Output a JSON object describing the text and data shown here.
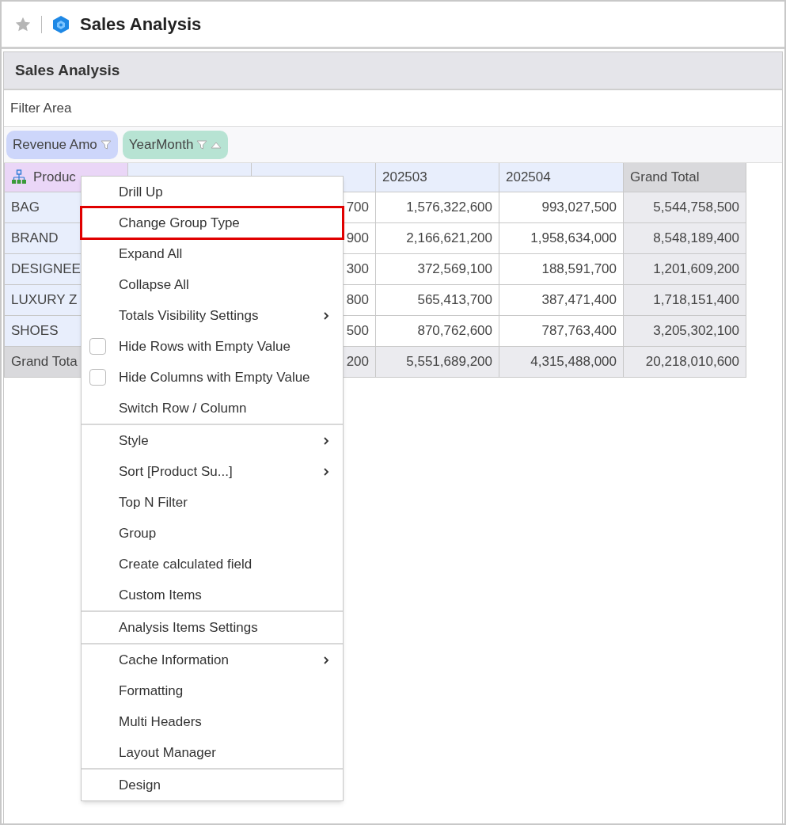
{
  "page": {
    "title": "Sales Analysis",
    "favorite": false
  },
  "panel": {
    "title": "Sales Analysis",
    "filter_area": "Filter Area",
    "pills": [
      {
        "label": "Revenue Amo",
        "kind": "measure",
        "sort": false
      },
      {
        "label": "YearMonth",
        "kind": "dimension",
        "sort": true
      }
    ],
    "table": {
      "columns": [
        {
          "label": "Produc",
          "kind": "row-field"
        },
        {
          "kind": "hidden"
        },
        {
          "kind": "hidden"
        },
        {
          "label": "202503",
          "kind": "period"
        },
        {
          "label": "202504",
          "kind": "period"
        },
        {
          "label": "Grand Total",
          "kind": "total"
        }
      ],
      "rows": [
        {
          "kind": "data",
          "cells": [
            "BAG",
            null,
            "700",
            "1,576,322,600",
            "993,027,500",
            "5,544,758,500"
          ]
        },
        {
          "kind": "data",
          "cells": [
            "BRAND",
            null,
            "900",
            "2,166,621,200",
            "1,958,634,000",
            "8,548,189,400"
          ]
        },
        {
          "kind": "data",
          "cells": [
            "DESIGNEE",
            null,
            "300",
            "372,569,100",
            "188,591,700",
            "1,201,609,200"
          ]
        },
        {
          "kind": "data",
          "cells": [
            "LUXURY Z",
            null,
            "800",
            "565,413,700",
            "387,471,400",
            "1,718,151,400"
          ]
        },
        {
          "kind": "data",
          "cells": [
            "SHOES",
            null,
            "500",
            "870,762,600",
            "787,763,400",
            "3,205,302,100"
          ]
        },
        {
          "kind": "total",
          "cells": [
            "Grand Tota",
            null,
            "200",
            "5,551,689,200",
            "4,315,488,000",
            "20,218,010,600"
          ]
        }
      ]
    }
  },
  "context_menu": {
    "sections": [
      [
        {
          "label": "Drill Up",
          "kind": "plain",
          "outlined": false
        },
        {
          "label": "Change Group Type",
          "kind": "plain",
          "outlined": true
        },
        {
          "label": "Expand All",
          "kind": "plain",
          "outlined": false
        },
        {
          "label": "Collapse All",
          "kind": "plain",
          "outlined": false
        },
        {
          "label": "Totals Visibility Settings",
          "kind": "submenu",
          "outlined": false
        },
        {
          "label": "Hide Rows with Empty Value",
          "kind": "checkbox",
          "checked": false,
          "outlined": false
        },
        {
          "label": "Hide Columns with Empty Value",
          "kind": "checkbox",
          "checked": false,
          "outlined": false
        },
        {
          "label": "Switch Row / Column",
          "kind": "plain",
          "outlined": false
        }
      ],
      [
        {
          "label": "Style",
          "kind": "submenu",
          "outlined": false
        },
        {
          "label": "Sort [Product Su...]",
          "kind": "submenu",
          "outlined": false
        },
        {
          "label": "Top N Filter",
          "kind": "plain",
          "outlined": false
        },
        {
          "label": "Group",
          "kind": "plain",
          "outlined": false
        },
        {
          "label": "Create calculated field",
          "kind": "plain",
          "outlined": false
        },
        {
          "label": "Custom Items",
          "kind": "plain",
          "outlined": false
        }
      ],
      [
        {
          "label": "Analysis Items Settings",
          "kind": "plain",
          "outlined": false
        }
      ],
      [
        {
          "label": "Cache Information",
          "kind": "submenu",
          "outlined": false
        },
        {
          "label": "Formatting",
          "kind": "plain",
          "outlined": false
        },
        {
          "label": "Multi Headers",
          "kind": "plain",
          "outlined": false
        },
        {
          "label": "Layout Manager",
          "kind": "plain",
          "outlined": false
        }
      ],
      [
        {
          "label": "Design",
          "kind": "plain",
          "outlined": false
        }
      ]
    ]
  }
}
